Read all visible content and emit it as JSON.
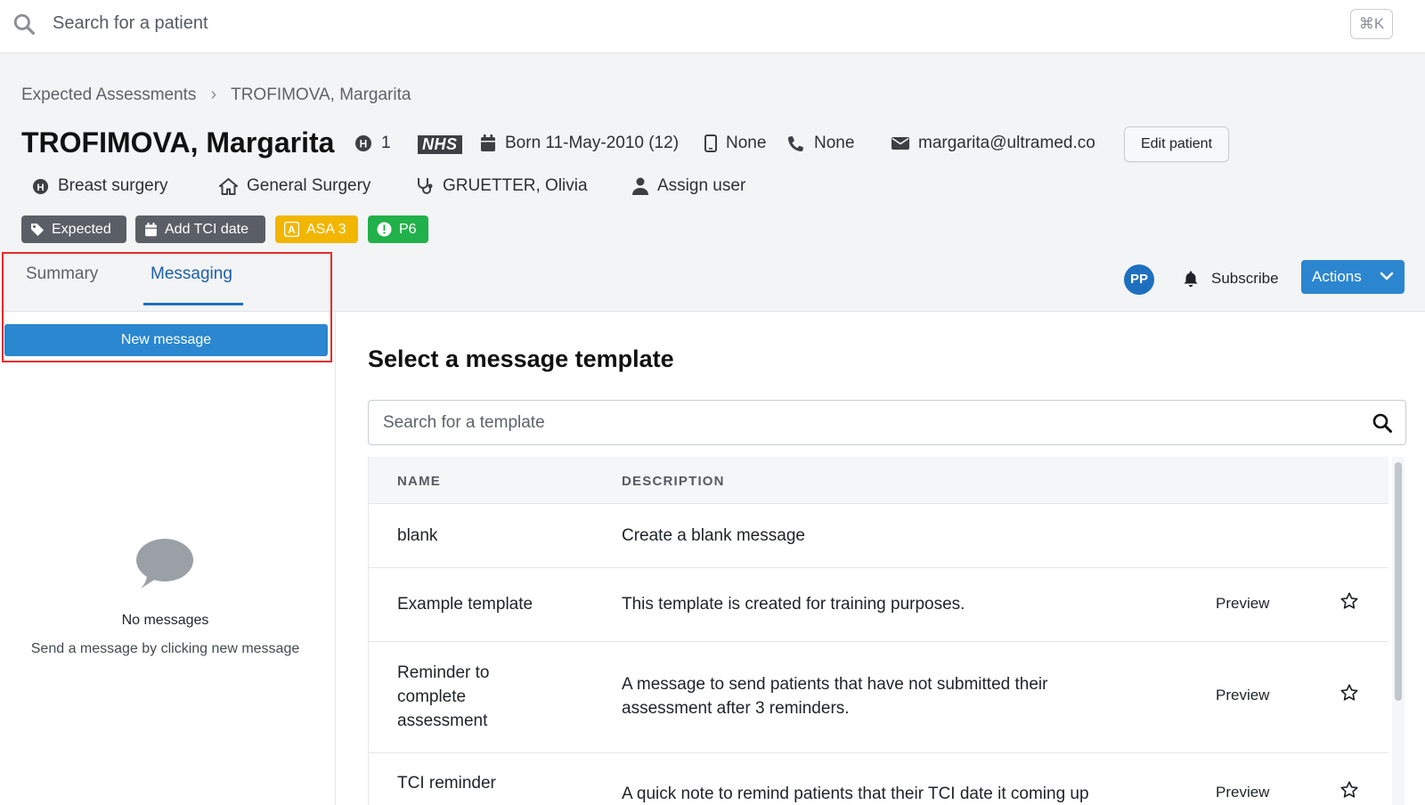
{
  "search": {
    "placeholder": "Search for a patient",
    "shortcut": "⌘K"
  },
  "breadcrumb": {
    "items": [
      "Expected Assessments",
      "TROFIMOVA, Margarita"
    ]
  },
  "patient": {
    "name": "TROFIMOVA, Margarita",
    "hospital_count": "1",
    "nhs_label": "NHS",
    "born": "Born 11-May-2010 (12)",
    "mobile": "None",
    "phone": "None",
    "email": "margarita@ultramed.co",
    "edit_label": "Edit patient"
  },
  "info": {
    "specialty": "Breast surgery",
    "department": "General Surgery",
    "clinician": "GRUETTER, Olivia",
    "assign": "Assign user"
  },
  "badges": {
    "expected": "Expected",
    "tci": "Add TCI date",
    "asa": "ASA 3",
    "priority": "P6"
  },
  "colors": {
    "accent": "#2b86cf",
    "badge_grey": "#5a5f66",
    "badge_yellow": "#f2b600",
    "badge_green": "#21b14a",
    "highlight": "#e62a2a"
  },
  "tabs": [
    {
      "label": "Summary"
    },
    {
      "label": "Messaging"
    }
  ],
  "toolbar": {
    "avatar": "PP",
    "subscribe": "Subscribe",
    "actions": "Actions"
  },
  "left": {
    "new_message": "New message",
    "empty_title": "No messages",
    "empty_sub": "Send a message by clicking new message"
  },
  "main": {
    "title": "Select a message template",
    "search_placeholder": "Search for a template",
    "columns": [
      "NAME",
      "DESCRIPTION"
    ],
    "preview_label": "Preview",
    "rows": [
      {
        "name": "blank",
        "description": "Create a blank message"
      },
      {
        "name": "Example template",
        "description": "This template is created for training purposes."
      },
      {
        "name_lines": [
          "Reminder to",
          "complete",
          "assessment"
        ],
        "description_lines": [
          "A message to send patients that have not submitted their",
          "assessment after 3 reminders."
        ]
      },
      {
        "name": "TCI reminder",
        "description": "A quick note to remind patients that their TCI date it coming up"
      }
    ]
  }
}
